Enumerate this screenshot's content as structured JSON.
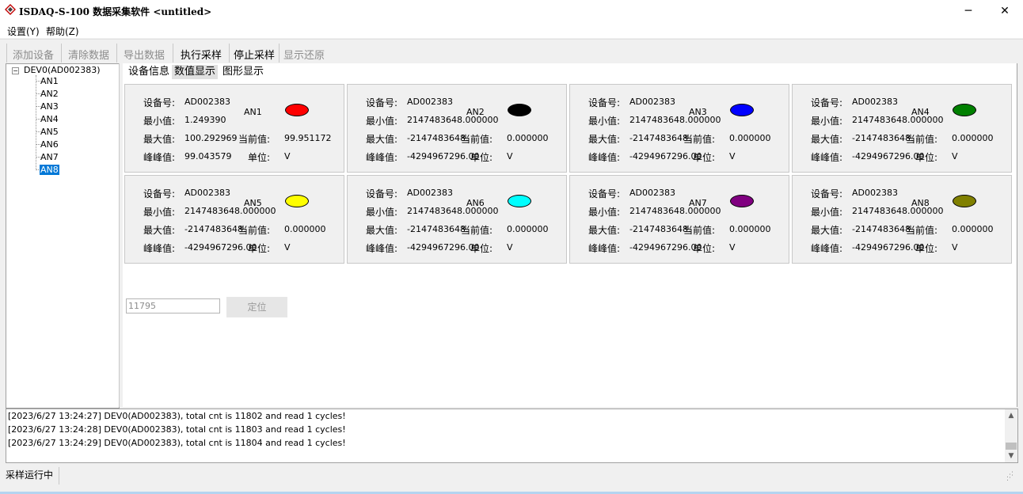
{
  "window": {
    "title": "ISDAQ-S-100 数据采集软件 <untitled>",
    "minimize_glyph": "─",
    "close_glyph": "✕"
  },
  "menu": {
    "items": [
      "设置(Y)",
      "帮助(Z)"
    ]
  },
  "toolbar": {
    "buttons": [
      {
        "label": "添加设备",
        "enabled": false
      },
      {
        "label": "清除数据",
        "enabled": false
      },
      {
        "label": "导出数据",
        "enabled": false
      },
      {
        "label": "执行采样",
        "enabled": true
      },
      {
        "label": "停止采样",
        "enabled": true
      },
      {
        "label": "显示还原",
        "enabled": false
      }
    ]
  },
  "tree": {
    "root": "DEV0(AD002383)",
    "expander": "−",
    "items": [
      "AN1",
      "AN2",
      "AN3",
      "AN4",
      "AN5",
      "AN6",
      "AN7",
      "AN8"
    ],
    "selected": "AN8"
  },
  "tabs": [
    "设备信息",
    "数值显示",
    "图形显示"
  ],
  "active_tab": "数值显示",
  "labels": {
    "device": "设备号:",
    "min": "最小值:",
    "max": "最大值:",
    "pp": "峰峰值:",
    "current": "当前值:",
    "unit": "单位:"
  },
  "channels": [
    {
      "name": "AN1",
      "device": "AD002383",
      "min": "1.249390",
      "max": "100.292969",
      "pp": "99.043579",
      "current": "99.951172",
      "unit": "V",
      "color": "#ff0000"
    },
    {
      "name": "AN2",
      "device": "AD002383",
      "min": "2147483648.000000",
      "max": "-2147483648.",
      "pp": "-4294967296.00",
      "current": "0.000000",
      "unit": "V",
      "color": "#000000"
    },
    {
      "name": "AN3",
      "device": "AD002383",
      "min": "2147483648.000000",
      "max": "-2147483648.",
      "pp": "-4294967296.00",
      "current": "0.000000",
      "unit": "V",
      "color": "#0000ff"
    },
    {
      "name": "AN4",
      "device": "AD002383",
      "min": "2147483648.000000",
      "max": "-2147483648.",
      "pp": "-4294967296.00",
      "current": "0.000000",
      "unit": "V",
      "color": "#008000"
    },
    {
      "name": "AN5",
      "device": "AD002383",
      "min": "2147483648.000000",
      "max": "-2147483648.",
      "pp": "-4294967296.00",
      "current": "0.000000",
      "unit": "V",
      "color": "#ffff00"
    },
    {
      "name": "AN6",
      "device": "AD002383",
      "min": "2147483648.000000",
      "max": "-2147483648.",
      "pp": "-4294967296.00",
      "current": "0.000000",
      "unit": "V",
      "color": "#00ffff"
    },
    {
      "name": "AN7",
      "device": "AD002383",
      "min": "2147483648.000000",
      "max": "-2147483648.",
      "pp": "-4294967296.00",
      "current": "0.000000",
      "unit": "V",
      "color": "#800080"
    },
    {
      "name": "AN8",
      "device": "AD002383",
      "min": "2147483648.000000",
      "max": "-2147483648.",
      "pp": "-4294967296.00",
      "current": "0.000000",
      "unit": "V",
      "color": "#808000"
    }
  ],
  "locate": {
    "input_value": "11795",
    "button_label": "定位"
  },
  "log": [
    "[2023/6/27 13:24:27] DEV0(AD002383), total cnt is 11802 and read 1 cycles!",
    "[2023/6/27 13:24:28] DEV0(AD002383), total cnt is 11803 and read 1 cycles!",
    "[2023/6/27 13:24:29] DEV0(AD002383), total cnt is 11804 and read 1 cycles!"
  ],
  "status": {
    "text": "采样运行中"
  }
}
